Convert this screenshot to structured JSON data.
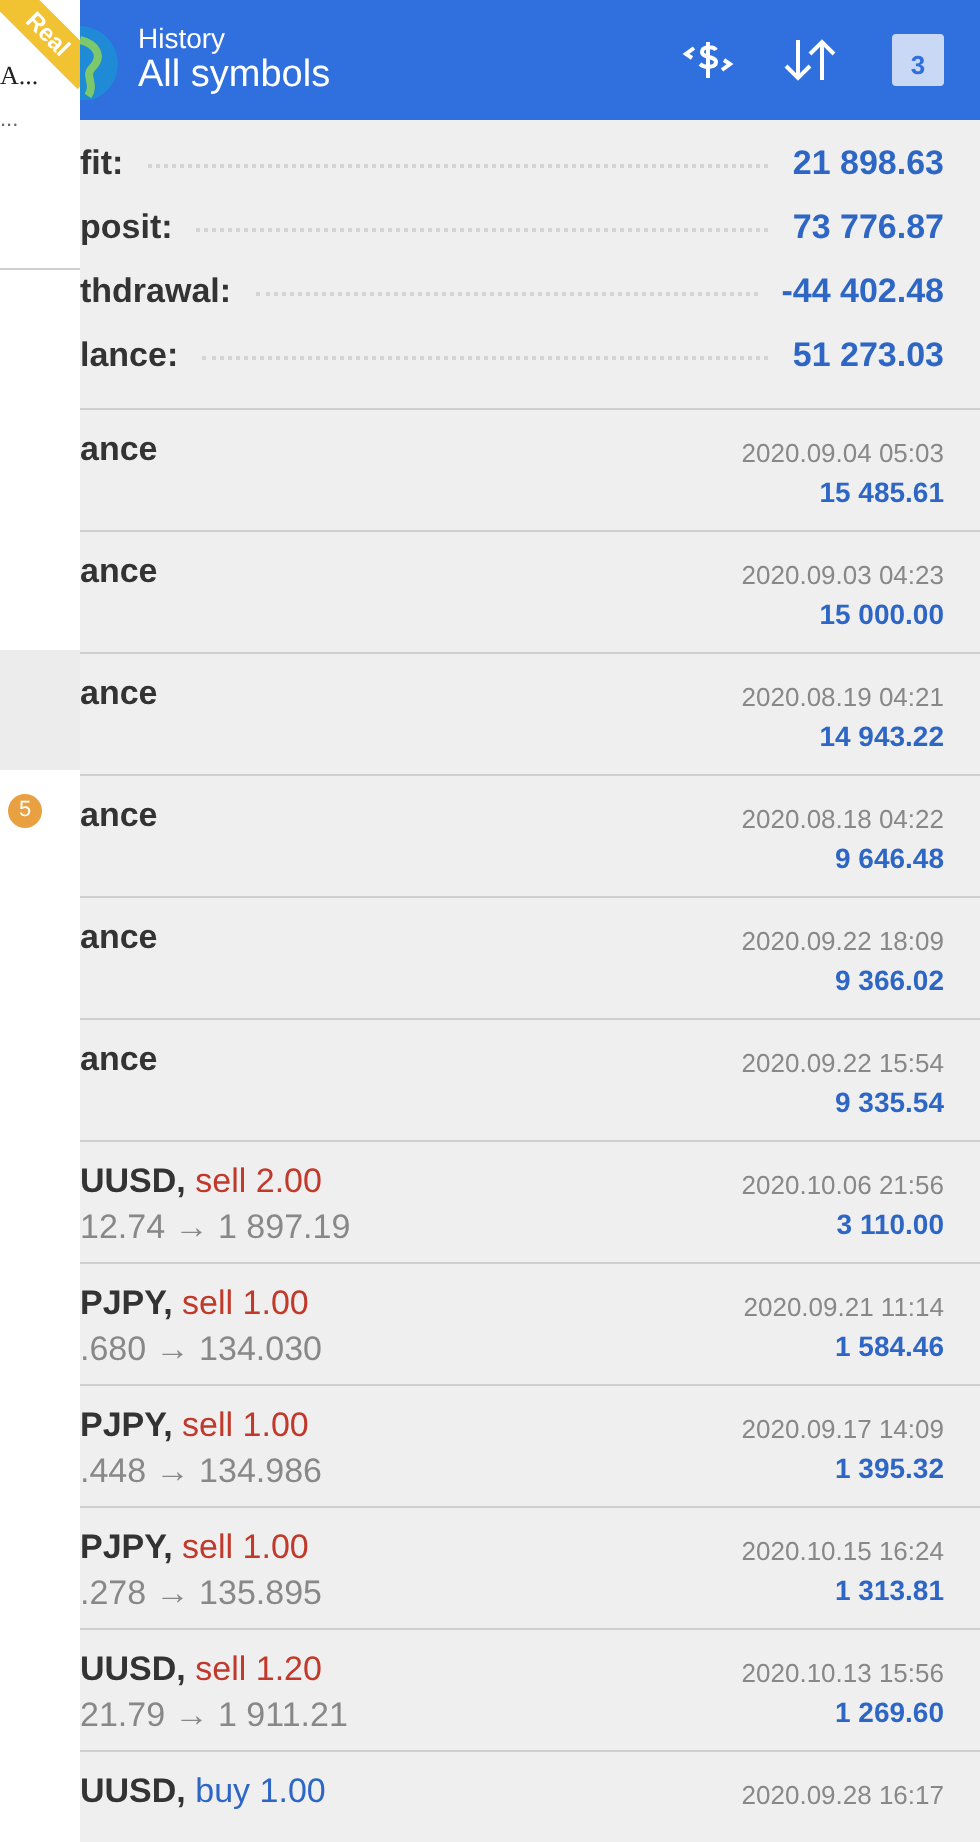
{
  "drawer": {
    "account_name": "A...",
    "account_detail": "...",
    "badge": "5",
    "ribbon": "Real"
  },
  "header": {
    "title": "History",
    "subtitle": "All symbols",
    "calendar_day": "3"
  },
  "summary": [
    {
      "label": "fit:",
      "value": "21 898.63"
    },
    {
      "label": "posit:",
      "value": "73 776.87"
    },
    {
      "label": "thdrawal:",
      "value": "-44 402.48"
    },
    {
      "label": "lance:",
      "value": "51 273.03"
    }
  ],
  "deals": [
    {
      "kind": "balance",
      "label": "ance",
      "time": "2020.09.04 05:03",
      "amount": "15 485.61"
    },
    {
      "kind": "balance",
      "label": "ance",
      "time": "2020.09.03 04:23",
      "amount": "15 000.00"
    },
    {
      "kind": "balance",
      "label": "ance",
      "time": "2020.08.19 04:21",
      "amount": "14 943.22"
    },
    {
      "kind": "balance",
      "label": "ance",
      "time": "2020.08.18 04:22",
      "amount": "9 646.48"
    },
    {
      "kind": "balance",
      "label": "ance",
      "time": "2020.09.22 18:09",
      "amount": "9 366.02"
    },
    {
      "kind": "balance",
      "label": "ance",
      "time": "2020.09.22 15:54",
      "amount": "9 335.54"
    },
    {
      "kind": "trade",
      "symbol": "UUSD,",
      "color": "#c0392b",
      "volume": "sell 2.00",
      "prices": "12.74 → 1 897.19",
      "time": "2020.10.06 21:56",
      "amount": "3 110.00"
    },
    {
      "kind": "trade",
      "symbol": "PJPY,",
      "color": "#c0392b",
      "volume": "sell 1.00",
      "prices": ".680 → 134.030",
      "time": "2020.09.21 11:14",
      "amount": "1 584.46"
    },
    {
      "kind": "trade",
      "symbol": "PJPY,",
      "color": "#c0392b",
      "volume": "sell 1.00",
      "prices": ".448 → 134.986",
      "time": "2020.09.17 14:09",
      "amount": "1 395.32"
    },
    {
      "kind": "trade",
      "symbol": "PJPY,",
      "color": "#c0392b",
      "volume": "sell 1.00",
      "prices": ".278 → 135.895",
      "time": "2020.10.15 16:24",
      "amount": "1 313.81"
    },
    {
      "kind": "trade",
      "symbol": "UUSD,",
      "color": "#c0392b",
      "volume": "sell 1.20",
      "prices": "21.79 → 1 911.21",
      "time": "2020.10.13 15:56",
      "amount": "1 269.60"
    },
    {
      "kind": "trade",
      "symbol": "UUSD,",
      "color": "#2d66c4",
      "volume": "buy 1.00",
      "time": "2020.09.28 16:17"
    }
  ]
}
